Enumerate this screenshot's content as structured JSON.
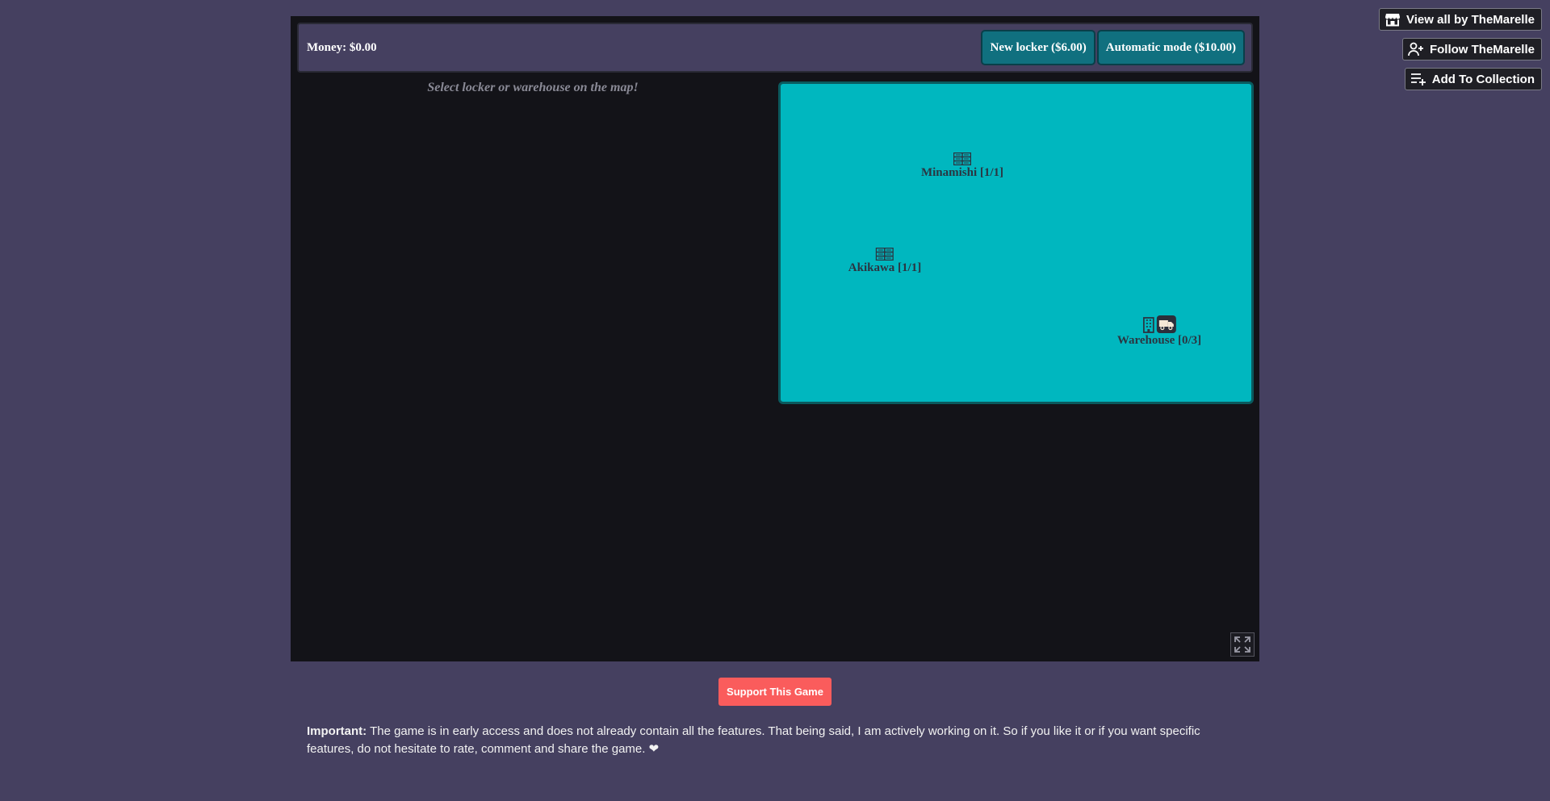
{
  "sidebar": {
    "buttons": [
      {
        "label": "View all by TheMarelle",
        "icon": "store-icon"
      },
      {
        "label": "Follow TheMarelle",
        "icon": "follow-user-icon"
      },
      {
        "label": "Add To Collection",
        "icon": "add-collection-icon"
      }
    ]
  },
  "game": {
    "money_label": "Money: $0.00",
    "buttons": {
      "new_locker": "New locker ($6.00)",
      "automatic_mode": "Automatic mode ($10.00)"
    },
    "hint": "Select locker or warehouse on the map!",
    "map": {
      "background_color": "#00b7bf",
      "pins": [
        {
          "label": "Minamishi [1/1]",
          "icon": "locker-icon"
        },
        {
          "label": "Akikawa [1/1]",
          "icon": "locker-icon"
        },
        {
          "label": "Warehouse [0/3]",
          "icon": "building-icon",
          "extra_icon": "truck-icon"
        }
      ]
    },
    "fullscreen_icon": "fullscreen-icon"
  },
  "support_button": "Support This Game",
  "notice": {
    "prefix": "Important:",
    "text": "The game is in early access and does not already contain all the features. That being said, I am actively working on it. So if you like it or if you want specific features, do not hesitate to rate, comment and share the game. ❤"
  },
  "colors": {
    "page_bg": "#454060",
    "game_bg": "#131318",
    "button_teal": "#10707f",
    "support_red": "#fa5c5c"
  }
}
